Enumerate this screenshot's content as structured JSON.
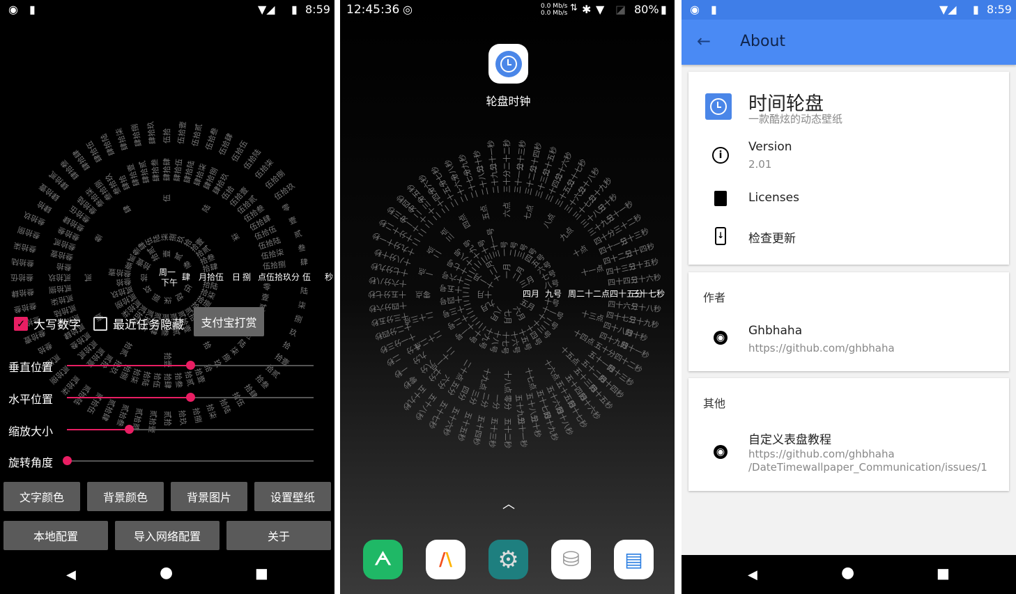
{
  "numerals": {
    "upper": [
      "零",
      "壹",
      "贰",
      "叁",
      "肆",
      "伍",
      "陆",
      "柒",
      "捌",
      "玖"
    ],
    "upper_ten": "拾",
    "lower": [
      "零",
      "一",
      "二",
      "三",
      "四",
      "五",
      "六",
      "七",
      "八",
      "九"
    ],
    "lower_ten": "十"
  },
  "left": {
    "status": {
      "time": "8:59"
    },
    "clock": {
      "center_top": "周一",
      "center_bottom": "下午",
      "current": [
        "肆",
        "月拾伍",
        "日",
        "捌",
        "点伍拾玖分",
        "伍",
        "秒"
      ]
    },
    "checkboxes": [
      {
        "label": "大写数字",
        "checked": true
      },
      {
        "label": "最近任务隐藏",
        "checked": false
      }
    ],
    "alipay_button": "支付宝打赏",
    "sliders": [
      {
        "label": "垂直位置",
        "value": 0.5
      },
      {
        "label": "水平位置",
        "value": 0.5
      },
      {
        "label": "缩放大小",
        "value": 0.25
      },
      {
        "label": "旋转角度",
        "value": 0
      }
    ],
    "buttons_row1": [
      "文字颜色",
      "背景颜色",
      "背景图片",
      "设置壁纸"
    ],
    "buttons_row2": [
      "本地配置",
      "导入网络配置",
      "关于"
    ],
    "accent": "#e91e63"
  },
  "mid": {
    "status": {
      "time": "12:45:36",
      "net_up": "0.0 Mb/s",
      "net_down": "0.0 Mb/s",
      "battery": "80%"
    },
    "app_label": "轮盘时钟",
    "clock": {
      "current": [
        "四月",
        "九号",
        "周二",
        "十二点",
        "四十五分",
        "三十七秒"
      ]
    },
    "dock": [
      "cloud-app-icon",
      "vlc-like-app-icon",
      "settings-app-icon",
      "database-app-icon",
      "file-explorer-app-icon"
    ]
  },
  "right": {
    "status": {
      "time": "8:59"
    },
    "appbar": {
      "title": "About",
      "color": "#4285f4"
    },
    "app": {
      "name": "时间轮盘",
      "subtitle": "一款酷炫的动态壁纸"
    },
    "version": {
      "label": "Version",
      "value": "2.01"
    },
    "licenses": "Licenses",
    "update": "检查更新",
    "author_section": "作者",
    "author": {
      "name": "Ghbhaha",
      "url": "https://github.com/ghbhaha"
    },
    "other_section": "其他",
    "tutorial": {
      "title": "自定义表盘教程",
      "url1": "https://github.com/ghbhaha",
      "url2": "/DateTimewallpaper_Communication/issues/1"
    }
  }
}
